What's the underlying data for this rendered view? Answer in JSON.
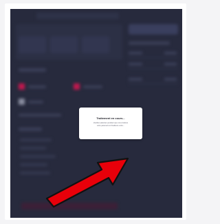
{
  "modal": {
    "title": "Traitement en cours...",
    "message_line1": "Veuillez patienter pendant que nous traitons",
    "message_line2": "votre paiement et finalisons votre..."
  },
  "annotation": {
    "icon": "red-arrow-icon",
    "fill_color": "#e8000a",
    "stroke_color": "#111111"
  },
  "colors": {
    "overlay_background": "#272a3d",
    "modal_background": "#ffffff",
    "accent_pink": "#c2184e"
  }
}
